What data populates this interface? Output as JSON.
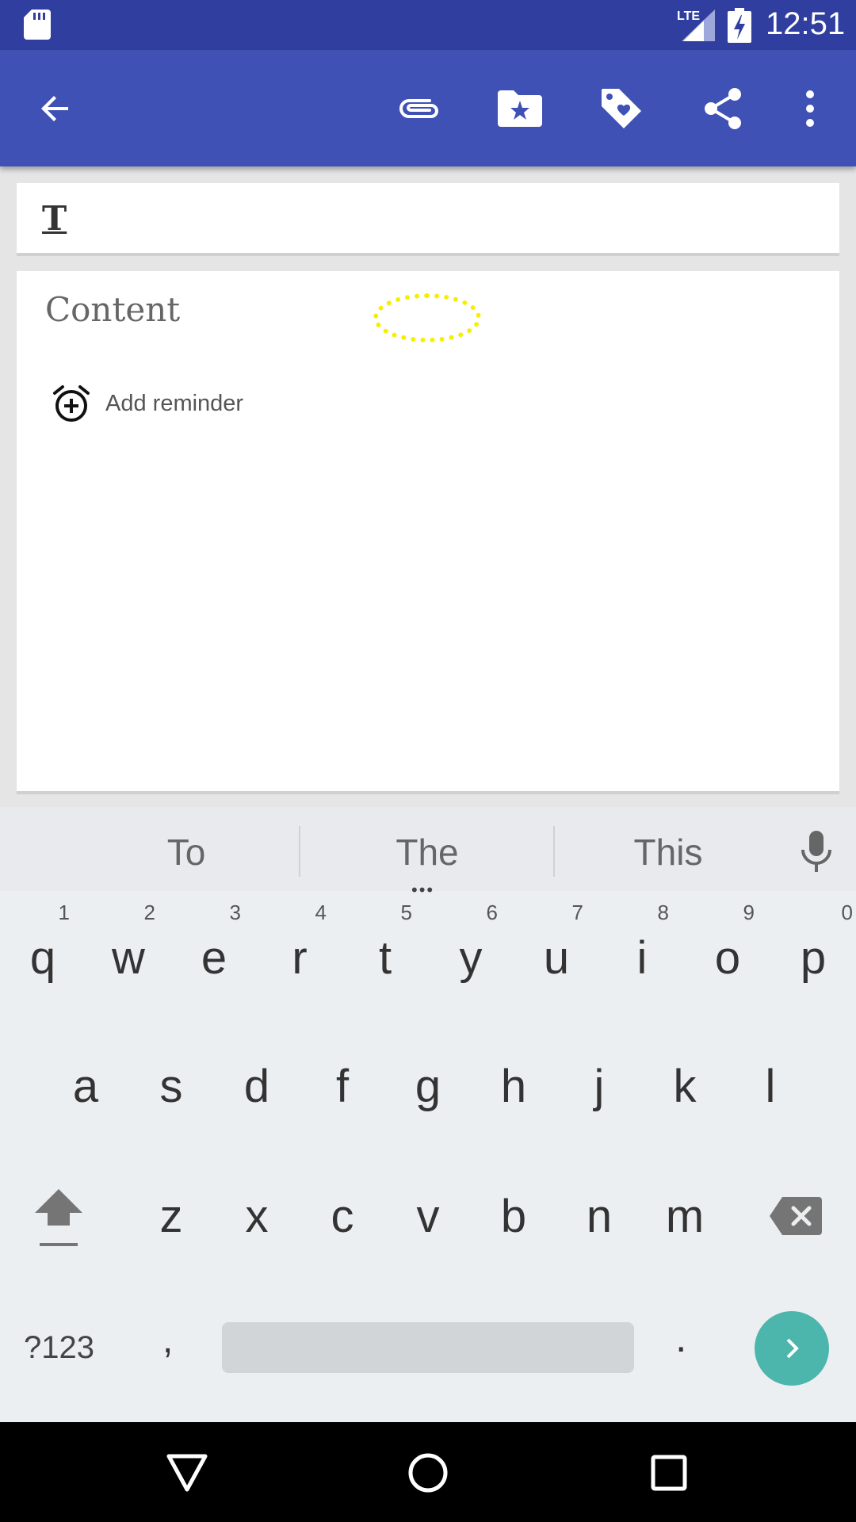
{
  "status_bar": {
    "time": "12:51",
    "network": "LTE",
    "icons": [
      "sd-card-icon",
      "signal-icon",
      "battery-charging-icon"
    ]
  },
  "app_bar": {
    "icons": [
      "back-arrow-icon",
      "attachment-icon",
      "folder-star-icon",
      "tag-heart-icon",
      "share-icon",
      "more-vert-icon"
    ]
  },
  "editor": {
    "title_placeholder": "",
    "content_placeholder": "Content",
    "add_reminder_label": "Add reminder"
  },
  "keyboard": {
    "suggestions": [
      "To",
      "The",
      "This"
    ],
    "row1": [
      "q",
      "w",
      "e",
      "r",
      "t",
      "y",
      "u",
      "i",
      "o",
      "p"
    ],
    "row1_numbers": [
      "1",
      "2",
      "3",
      "4",
      "5",
      "6",
      "7",
      "8",
      "9",
      "0"
    ],
    "row2": [
      "a",
      "s",
      "d",
      "f",
      "g",
      "h",
      "j",
      "k",
      "l"
    ],
    "row3": [
      "z",
      "x",
      "c",
      "v",
      "b",
      "n",
      "m"
    ],
    "symbols_label": "?123",
    "comma": ",",
    "period": ".",
    "accent_color": "#4db6ac"
  },
  "colors": {
    "primary": "#3f51b5",
    "primary_dark": "#303f9f"
  }
}
